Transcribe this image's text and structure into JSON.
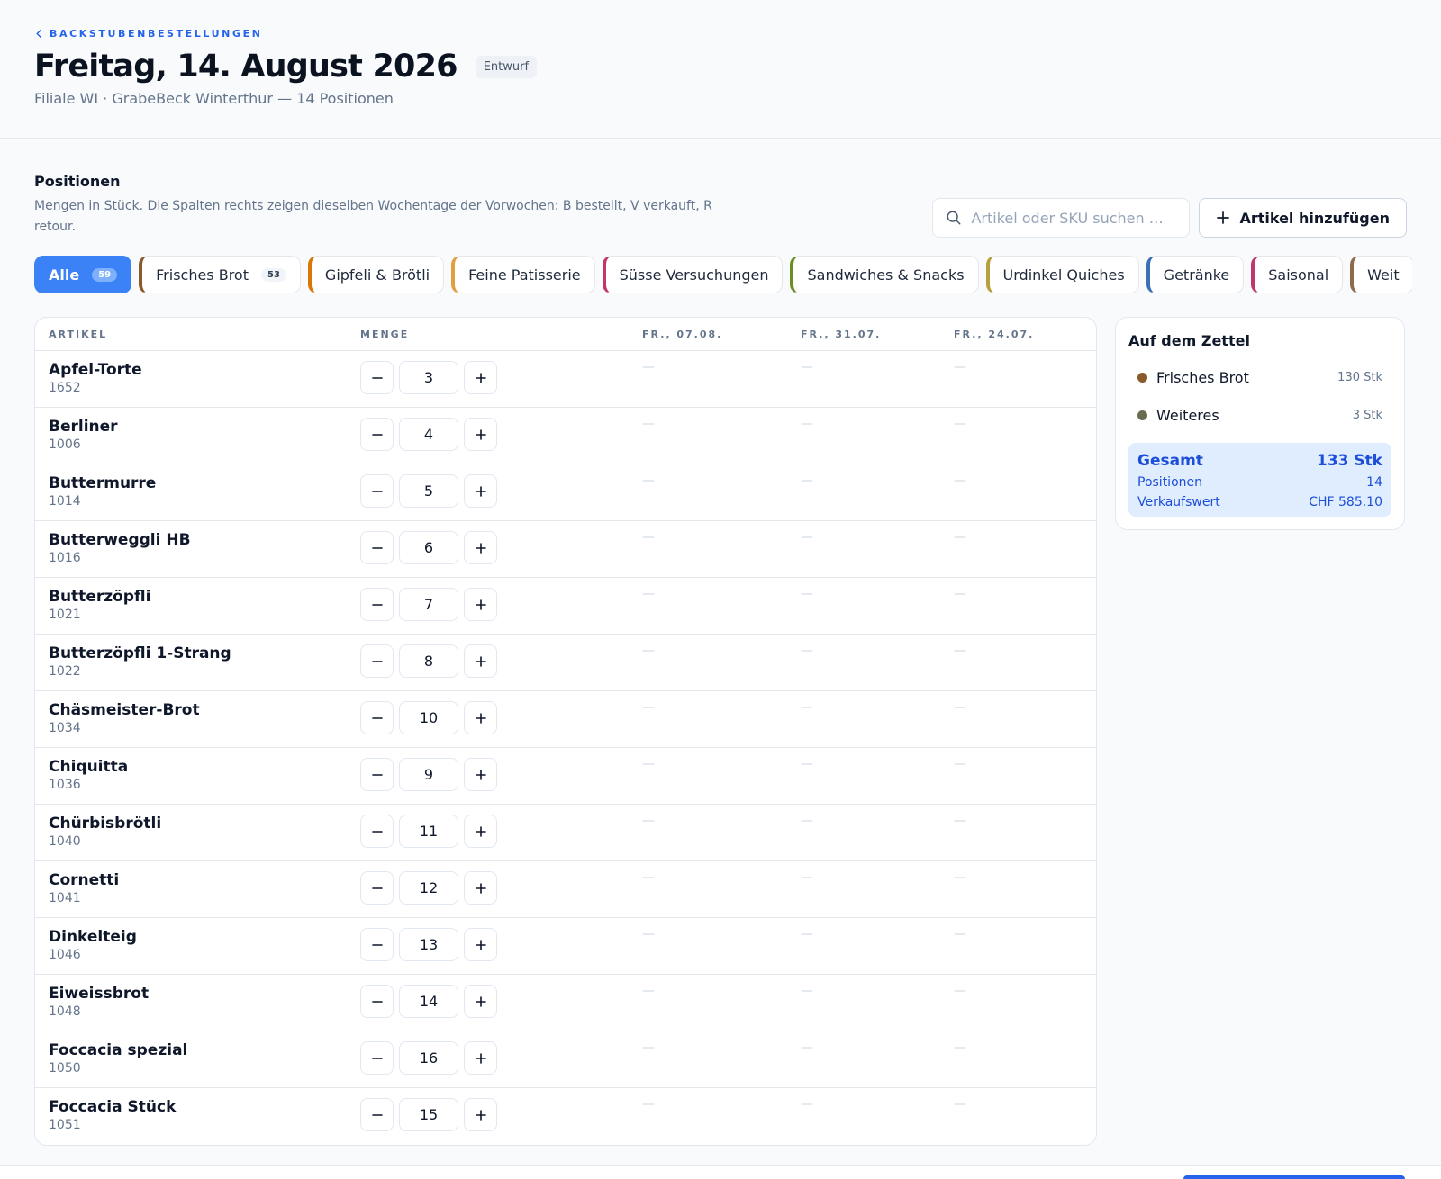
{
  "header": {
    "back_label": "BACKSTUBENBESTELLUNGEN",
    "title": "Freitag, 14. August 2026",
    "status": "Entwurf",
    "subtitle": "Filiale WI · GrabeBeck Winterthur — 14 Positionen"
  },
  "section": {
    "title": "Positionen",
    "description": "Mengen in Stück. Die Spalten rechts zeigen dieselben Wochentage der Vorwochen: B bestellt, V verkauft, R retour.",
    "search_placeholder": "Artikel oder SKU suchen …",
    "add_label": "Artikel hinzufügen"
  },
  "tabs": [
    {
      "label": "Alle",
      "count": "59",
      "active": true,
      "color": "#3b82f6"
    },
    {
      "label": "Frisches Brot",
      "count": "53",
      "color": "#8b5a2b"
    },
    {
      "label": "Gipfeli & Brötli",
      "color": "#d97706"
    },
    {
      "label": "Feine Patisserie",
      "color": "#e0a040"
    },
    {
      "label": "Süsse Versuchungen",
      "color": "#c0386b"
    },
    {
      "label": "Sandwiches & Snacks",
      "color": "#6b8e23"
    },
    {
      "label": "Urdinkel Quiches",
      "color": "#b5a03c"
    },
    {
      "label": "Getränke",
      "color": "#3b6fb5"
    },
    {
      "label": "Saisonal",
      "color": "#c0386b"
    },
    {
      "label": "Weit",
      "color": "#8b6b4a"
    }
  ],
  "table": {
    "headers": {
      "article": "ARTIKEL",
      "qty": "MENGE",
      "w1": "FR., 07.08.",
      "w2": "FR., 31.07.",
      "w3": "FR., 24.07."
    },
    "empty_symbol": "—",
    "rows": [
      {
        "name": "Apfel-Torte",
        "sku": "1652",
        "qty": "3"
      },
      {
        "name": "Berliner",
        "sku": "1006",
        "qty": "4"
      },
      {
        "name": "Buttermurre",
        "sku": "1014",
        "qty": "5"
      },
      {
        "name": "Butterweggli HB",
        "sku": "1016",
        "qty": "6"
      },
      {
        "name": "Butterzöpfli",
        "sku": "1021",
        "qty": "7"
      },
      {
        "name": "Butterzöpfli 1-Strang",
        "sku": "1022",
        "qty": "8"
      },
      {
        "name": "Chäsmeister-Brot",
        "sku": "1034",
        "qty": "10"
      },
      {
        "name": "Chiquitta",
        "sku": "1036",
        "qty": "9"
      },
      {
        "name": "Chürbisbrötli",
        "sku": "1040",
        "qty": "11"
      },
      {
        "name": "Cornetti",
        "sku": "1041",
        "qty": "12"
      },
      {
        "name": "Dinkelteig",
        "sku": "1046",
        "qty": "13"
      },
      {
        "name": "Eiweissbrot",
        "sku": "1048",
        "qty": "14"
      },
      {
        "name": "Foccacia spezial",
        "sku": "1050",
        "qty": "16"
      },
      {
        "name": "Foccacia Stück",
        "sku": "1051",
        "qty": "15"
      }
    ]
  },
  "summary": {
    "title": "Auf dem Zettel",
    "items": [
      {
        "label": "Frisches Brot",
        "value": "130 Stk",
        "color": "#8b5a2b"
      },
      {
        "label": "Weiteres",
        "value": "3 Stk",
        "color": "#6b6b50"
      }
    ],
    "total_label": "Gesamt",
    "total_value": "133 Stk",
    "positions_label": "Positionen",
    "positions_value": "14",
    "value_label": "Verkaufswert",
    "value_value": "CHF 585.10"
  },
  "colors": {
    "accent": "#2563eb",
    "accent_bg": "#e0edff"
  }
}
